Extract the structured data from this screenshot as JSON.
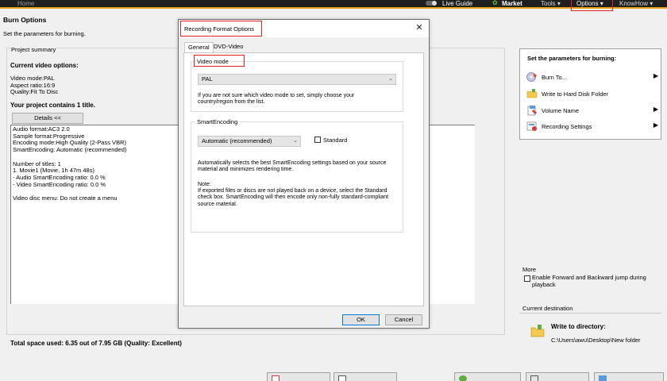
{
  "topbar": {
    "home": "Home",
    "live_guide": "Live Guide",
    "market": "Market",
    "tools": "Tools ▾",
    "options": "Options ▾",
    "knowhow": "KnowHow ▾"
  },
  "page": {
    "title": "Burn Options",
    "subtitle": "Set the parameters for burning."
  },
  "summary": {
    "heading": "Project summary",
    "current_options_title": "Current video options:",
    "option_lines": [
      "Video mode:PAL",
      "Aspect ratio:16:9",
      "Quality:Fit To Disc"
    ],
    "project_title": "Your project contains 1 title.",
    "details_button": "Details <<",
    "details_lines": [
      "Audio format:AC3 2.0",
      "Sample format:Progressive",
      "Encoding mode:High Quality (2-Pass VBR)",
      "SmartEncoding: Automatic (recommended)",
      "",
      "Number of titles: 1",
      "1. Movie1 (Movie, 1h 47m 48s)",
      "- Audio SmartEncoding ratio: 0.0 %",
      "- Video SmartEncoding ratio: 0.0 %",
      "",
      "Video disc menu: Do not create a menu"
    ],
    "total_space": "Total space used: 6.35 out of 7.95 GB (Quality: Excellent)"
  },
  "right_panel": {
    "title": "Set the parameters for burning:",
    "items": [
      {
        "label": "Burn To...",
        "icon": "disc-burn-icon",
        "has_arrow": true
      },
      {
        "label": "Write to Hard Disk Folder",
        "icon": "folder-icon",
        "has_arrow": false
      },
      {
        "label": "Volume Name",
        "icon": "volume-name-icon",
        "has_arrow": true
      },
      {
        "label": "Recording Settings",
        "icon": "recording-settings-icon",
        "has_arrow": true
      }
    ],
    "arrow_glyph": "▶",
    "more_label": "More",
    "forward_backward_label": "Enable Forward and Backward jump during playback",
    "destination_label": "Current destination",
    "destination_title": "Write to directory:",
    "destination_path": "C:\\Users\\awu\\Desktop\\New folder"
  },
  "dialog": {
    "title": "Recording Format Options",
    "close_glyph": "✕",
    "tabs": [
      "General",
      "DVD-Video"
    ],
    "video_mode_legend": "Video mode",
    "video_mode_value": "PAL",
    "video_mode_help": "If you are not sure which video mode to set, simply choose your country/region from the list.",
    "smart_legend": "SmartEncoding",
    "smart_value": "Automatic (recommended)",
    "standard_label": "Standard",
    "smart_help": "Automatically selects the best SmartEncoding settings based on your source material and minimizes rendering time.",
    "note_label": "Note:",
    "note_text": "If exported files or discs are not played back on a device, select the Standard check box. SmartEncoding will then encode only non-fully standard-compliant source material.",
    "ok": "OK",
    "cancel": "Cancel",
    "combo_arrow": "⌄"
  },
  "colors": {
    "accent_orange": "#e8a317",
    "highlight_red": "#e52222",
    "focus_blue": "#0078d7"
  }
}
